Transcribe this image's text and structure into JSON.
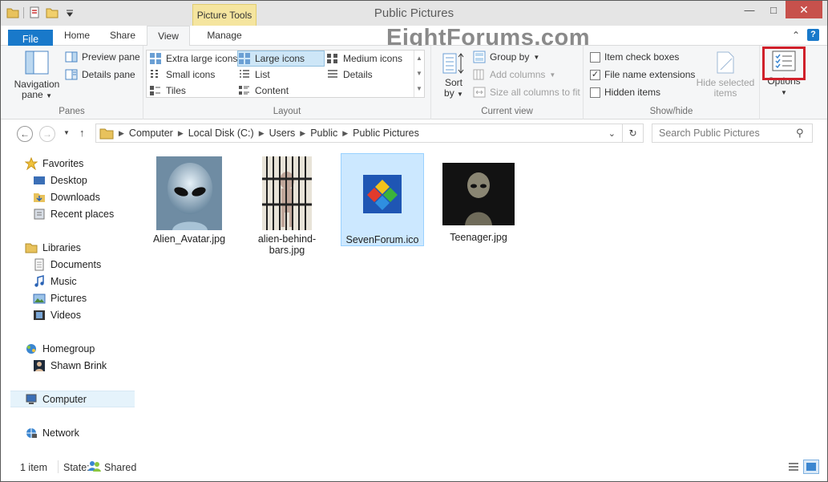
{
  "window": {
    "title": "Public Pictures",
    "context_tab": "Picture Tools"
  },
  "watermark": "EightForums.com",
  "tabs": {
    "file": "File",
    "home": "Home",
    "share": "Share",
    "view": "View",
    "manage": "Manage"
  },
  "ribbon": {
    "panes": {
      "label": "Panes",
      "navigation_pane": "Navigation pane",
      "preview_pane": "Preview pane",
      "details_pane": "Details pane"
    },
    "layout": {
      "label": "Layout",
      "options": [
        "Extra large icons",
        "Large icons",
        "Medium icons",
        "Small icons",
        "List",
        "Details",
        "Tiles",
        "Content"
      ],
      "selected": "Large icons"
    },
    "current_view": {
      "label": "Current view",
      "sort_by": "Sort by",
      "group_by": "Group by",
      "add_columns": "Add columns",
      "size_columns": "Size all columns to fit"
    },
    "show_hide": {
      "label": "Show/hide",
      "item_check_boxes": {
        "label": "Item check boxes",
        "checked": false
      },
      "file_name_extensions": {
        "label": "File name extensions",
        "checked": true
      },
      "hidden_items": {
        "label": "Hidden items",
        "checked": false
      },
      "hide_selected": "Hide selected items"
    },
    "options": "Options"
  },
  "address": {
    "crumbs": [
      "Computer",
      "Local Disk (C:)",
      "Users",
      "Public",
      "Public Pictures"
    ],
    "search_placeholder": "Search Public Pictures"
  },
  "navpane": {
    "favorites": "Favorites",
    "desktop": "Desktop",
    "downloads": "Downloads",
    "recent": "Recent places",
    "libraries": "Libraries",
    "documents": "Documents",
    "music": "Music",
    "pictures": "Pictures",
    "videos": "Videos",
    "homegroup": "Homegroup",
    "user": "Shawn Brink",
    "computer": "Computer",
    "network": "Network"
  },
  "files": [
    {
      "name": "Alien_Avatar.jpg"
    },
    {
      "name": "alien-behind-bars.jpg"
    },
    {
      "name": "SevenForum.ico"
    },
    {
      "name": "Teenager.jpg"
    }
  ],
  "status": {
    "count": "1 item",
    "state_label": "State:",
    "state_value": "Shared"
  }
}
